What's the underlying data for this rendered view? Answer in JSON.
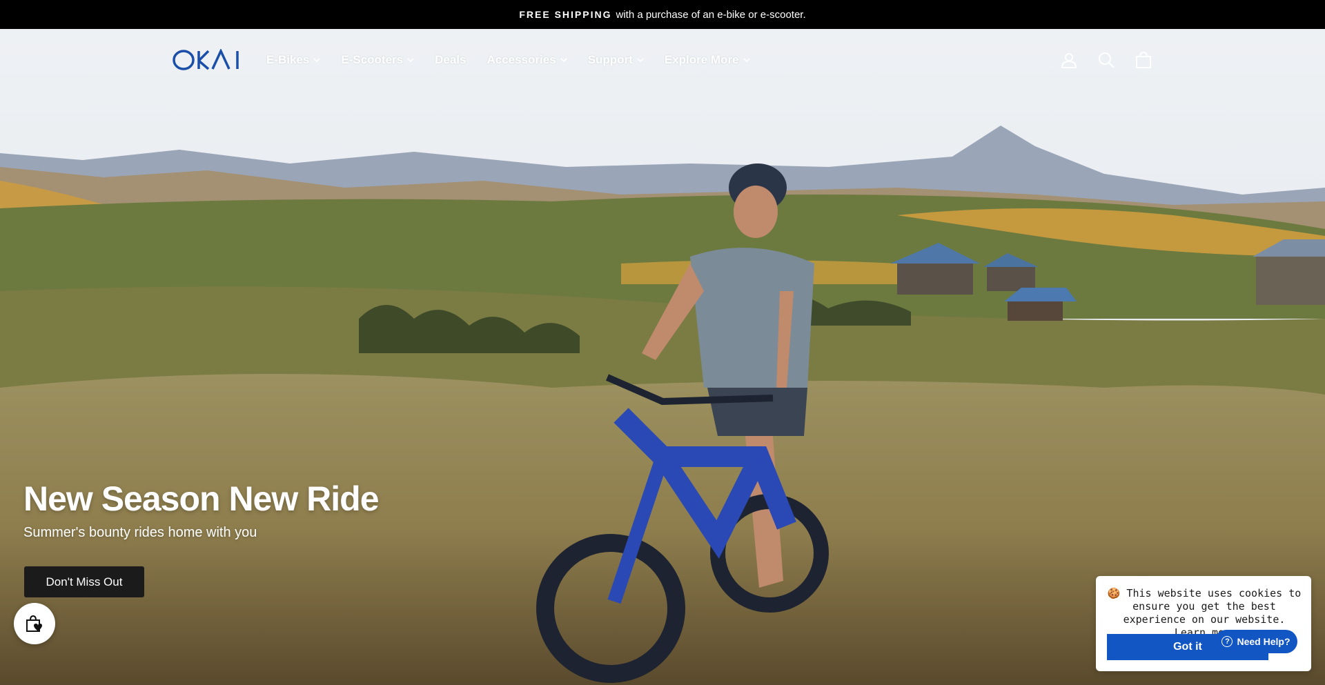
{
  "announcement": {
    "strong": "FREE SHIPPING",
    "rest": "with a purchase of an e-bike or e-scooter."
  },
  "header": {
    "logo_text": "OKAI",
    "nav": [
      {
        "label": "E-Bikes",
        "has_dropdown": true
      },
      {
        "label": "E-Scooters",
        "has_dropdown": true
      },
      {
        "label": "Deals",
        "has_dropdown": false
      },
      {
        "label": "Accessories",
        "has_dropdown": true
      },
      {
        "label": "Support",
        "has_dropdown": true
      },
      {
        "label": "Explore More",
        "has_dropdown": true
      }
    ],
    "icons": [
      "account-icon",
      "search-icon",
      "cart-icon"
    ]
  },
  "hero": {
    "title": "New Season New Ride",
    "subtitle": "Summer's bounty rides home with you",
    "button_label": "Don't Miss Out"
  },
  "cookie": {
    "emoji": "🍪",
    "text": "This website uses cookies to ensure you get the best experience on our website.",
    "learn_more": "Learn more",
    "button_label": "Got it"
  },
  "help": {
    "label": "Need Help?"
  },
  "colors": {
    "logo": "#1a4ea8",
    "accent_blue": "#1256c4",
    "button_dark": "#1b1b1b"
  }
}
